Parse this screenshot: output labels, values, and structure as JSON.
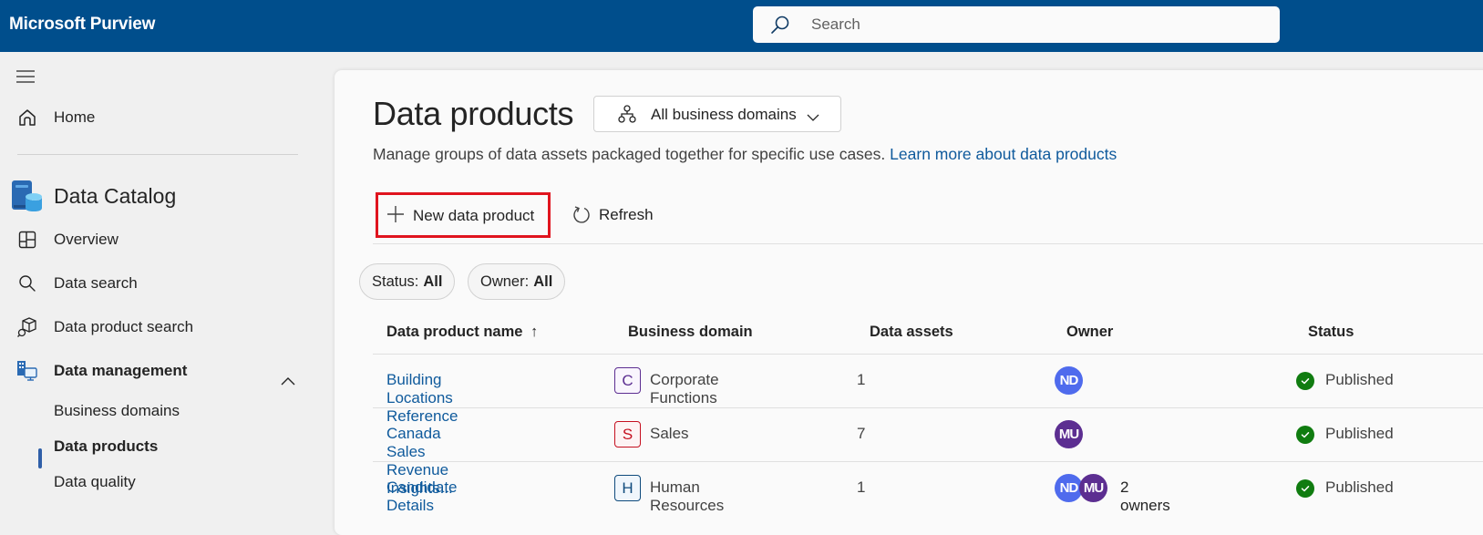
{
  "topbar": {
    "app_title": "Microsoft Purview",
    "search_placeholder": "Search"
  },
  "sidebar": {
    "menu_icon": "hamburger-icon",
    "home": {
      "label": "Home",
      "icon": "home-icon"
    },
    "section_title": "Data Catalog",
    "section_icon": "data-catalog-icon",
    "items": [
      {
        "label": "Overview",
        "icon": "overview-grid-icon"
      },
      {
        "label": "Data search",
        "icon": "search-icon"
      },
      {
        "label": "Data product search",
        "icon": "cube-search-icon"
      },
      {
        "label": "Data management",
        "icon": "data-management-icon",
        "expanded": true
      }
    ],
    "sub_items": [
      {
        "label": "Business domains",
        "active": false
      },
      {
        "label": "Data products",
        "active": true
      },
      {
        "label": "Data quality",
        "active": false
      }
    ]
  },
  "main": {
    "title": "Data products",
    "domain_filter": {
      "label": "All business domains",
      "icon": "hierarchy-icon"
    },
    "description": "Manage groups of data assets packaged together for specific use cases.",
    "learn_more_link": "Learn more about data products",
    "toolbar": {
      "new_label": "New data product",
      "refresh_label": "Refresh"
    },
    "filters": [
      {
        "key": "Status:",
        "value": "All"
      },
      {
        "key": "Owner:",
        "value": "All"
      }
    ],
    "table": {
      "columns": [
        "Data product name",
        "Business domain",
        "Data assets",
        "Owner",
        "Status"
      ],
      "sort_indicator": "↑",
      "rows": [
        {
          "name": "Building Locations Reference",
          "domain_letter": "C",
          "domain": "Corporate Functions",
          "domain_color": "#5c2e91",
          "assets": "1",
          "owners": [
            {
              "initials": "ND",
              "color": "#4f6bed"
            }
          ],
          "owners_label": "",
          "status": "Published"
        },
        {
          "name": "Canada Sales Revenue Insights...",
          "domain_letter": "S",
          "domain": "Sales",
          "domain_color": "#c50f1f",
          "assets": "7",
          "owners": [
            {
              "initials": "MU",
              "color": "#5c2e91"
            }
          ],
          "owners_label": "",
          "status": "Published"
        },
        {
          "name": "Candidate Details",
          "domain_letter": "H",
          "domain": "Human Resources",
          "domain_color": "#0f4a7c",
          "assets": "1",
          "owners": [
            {
              "initials": "ND",
              "color": "#4f6bed"
            },
            {
              "initials": "MU",
              "color": "#5c2e91"
            }
          ],
          "owners_label": "2 owners",
          "status": "Published"
        }
      ]
    },
    "status_color": "#107c10",
    "highlight_color": "#e0141e"
  }
}
